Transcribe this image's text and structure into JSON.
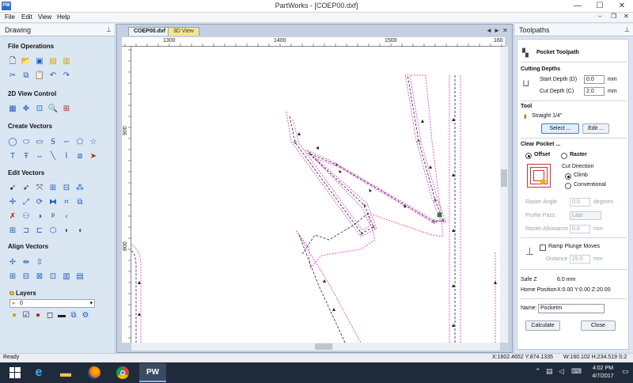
{
  "app": {
    "icon_label": "PW",
    "title": "PartWorks - [COEP00.dxf]",
    "minimize": "—",
    "maximize": "☐",
    "close": "✕"
  },
  "menu": {
    "items": [
      "File",
      "Edit",
      "View",
      "Help"
    ],
    "doc_min": "–",
    "doc_max": "❐",
    "doc_close": "✕"
  },
  "drawing_panel": {
    "title": "Drawing",
    "pin": "⊥",
    "sections": {
      "file_operations": "File Operations",
      "view_control": "2D View Control",
      "create_vectors": "Create Vectors",
      "edit_vectors": "Edit Vectors",
      "align_vectors": "Align Vectors",
      "layers": "Layers"
    },
    "layer_value": "0"
  },
  "document": {
    "tabs": [
      "COEP00.dxf",
      "3D View"
    ],
    "ctrl_left": "◄",
    "ctrl_right": "►",
    "ctrl_close": "✕",
    "ruler_h": [
      "1300",
      "1400",
      "1500",
      "160"
    ],
    "ruler_v": [
      "900",
      "800"
    ]
  },
  "toolpaths": {
    "title": "Toolpaths",
    "pin": "⊥",
    "heading": "Pocket Toolpath",
    "cutting_depths": "Cutting Depths",
    "start_depth_label": "Start Depth (D)",
    "start_depth_value": "0.0",
    "cut_depth_label": "Cut Depth (C)",
    "cut_depth_value": "2.0",
    "unit": "mm",
    "tool_label": "Tool",
    "tool_name": "Straight 1/4\"",
    "select_button": "Select ...",
    "edit_button": "Edit ...",
    "clear_pocket": "Clear Pocket ...",
    "offset_label": "Offset",
    "raster_label": "Raster",
    "cut_direction": "Cut Direction",
    "climb": "Climb",
    "conventional": "Conventional",
    "raster_angle_label": "Raster Angle",
    "raster_angle_value": "0.0",
    "degrees": "degrees",
    "profile_pass_label": "Profile Pass",
    "profile_pass_value": "Last",
    "raster_allowance_label": "Raster Allowance",
    "raster_allowance_value": "0.0",
    "ramp_label": "Ramp Plunge Moves",
    "distance_label": "Distance",
    "distance_value": "25.0",
    "safe_z_label": "Safe Z",
    "safe_z_value": "6.0 mm",
    "home_label": "Home Position",
    "home_value": "X:0.00 Y:0.00 Z:20.00",
    "name_label": "Name:",
    "name_value": "Pocketm",
    "calculate_button": "Calculate",
    "close_button": "Close"
  },
  "status": {
    "ready": "Ready",
    "coords": "X:1602.4652 Y:874.1335",
    "size": "W:160.102  H:234.519  S:2"
  },
  "taskbar": {
    "active_app": "PW",
    "time": "4:02 PM",
    "date": "4/7/2017"
  }
}
